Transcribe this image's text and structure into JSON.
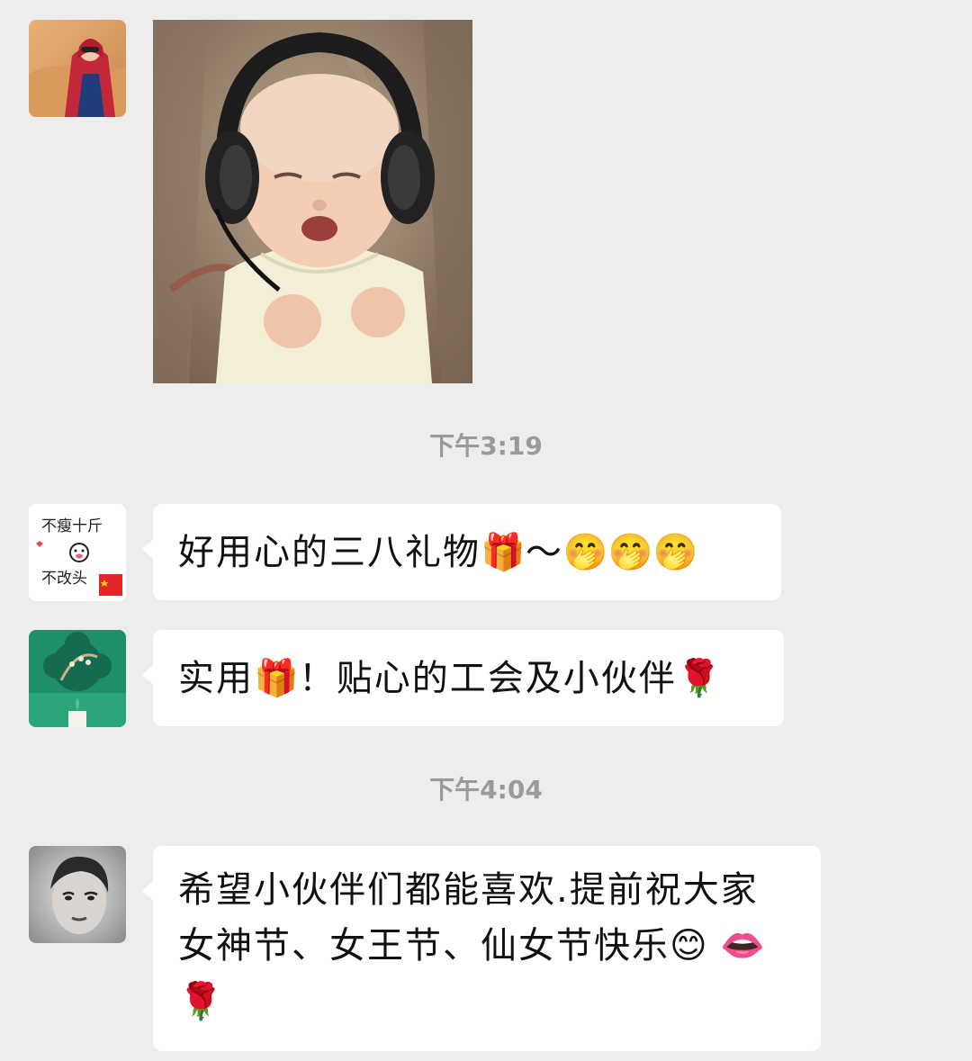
{
  "messages": [
    {
      "avatar": "desert-red-scarf-avatar",
      "type": "image",
      "image": "baby-headphones-photo"
    },
    {
      "type": "timestamp",
      "text": "下午3:19"
    },
    {
      "avatar": "cartoon-pig-avatar",
      "avatar_text": {
        "line1": "不瘦十斤",
        "line2": "不改头"
      },
      "type": "text",
      "text": "好用心的三八礼物",
      "emojis": [
        "🎁",
        "～",
        "🤭",
        "🤭",
        "🤭"
      ]
    },
    {
      "avatar": "green-emblem-avatar",
      "type": "text",
      "text_a": "实用",
      "emoji_a": "🎁",
      "text_b": "！贴心的工会及小伙伴",
      "emoji_b": "🌹"
    },
    {
      "type": "timestamp",
      "text": "下午4:04"
    },
    {
      "avatar": "vintage-portrait-avatar",
      "type": "text",
      "line1": "希望小伙伴们都能喜欢.提前祝大家",
      "line2": "女神节、女王节、仙女节快乐",
      "emoji_smile": "😊",
      "emoji_lips": "👄",
      "emoji_rose": "🌹"
    }
  ],
  "colors": {
    "background": "#ededed",
    "bubble": "#ffffff",
    "timestamp": "#9a9a9a",
    "text": "#111111"
  }
}
